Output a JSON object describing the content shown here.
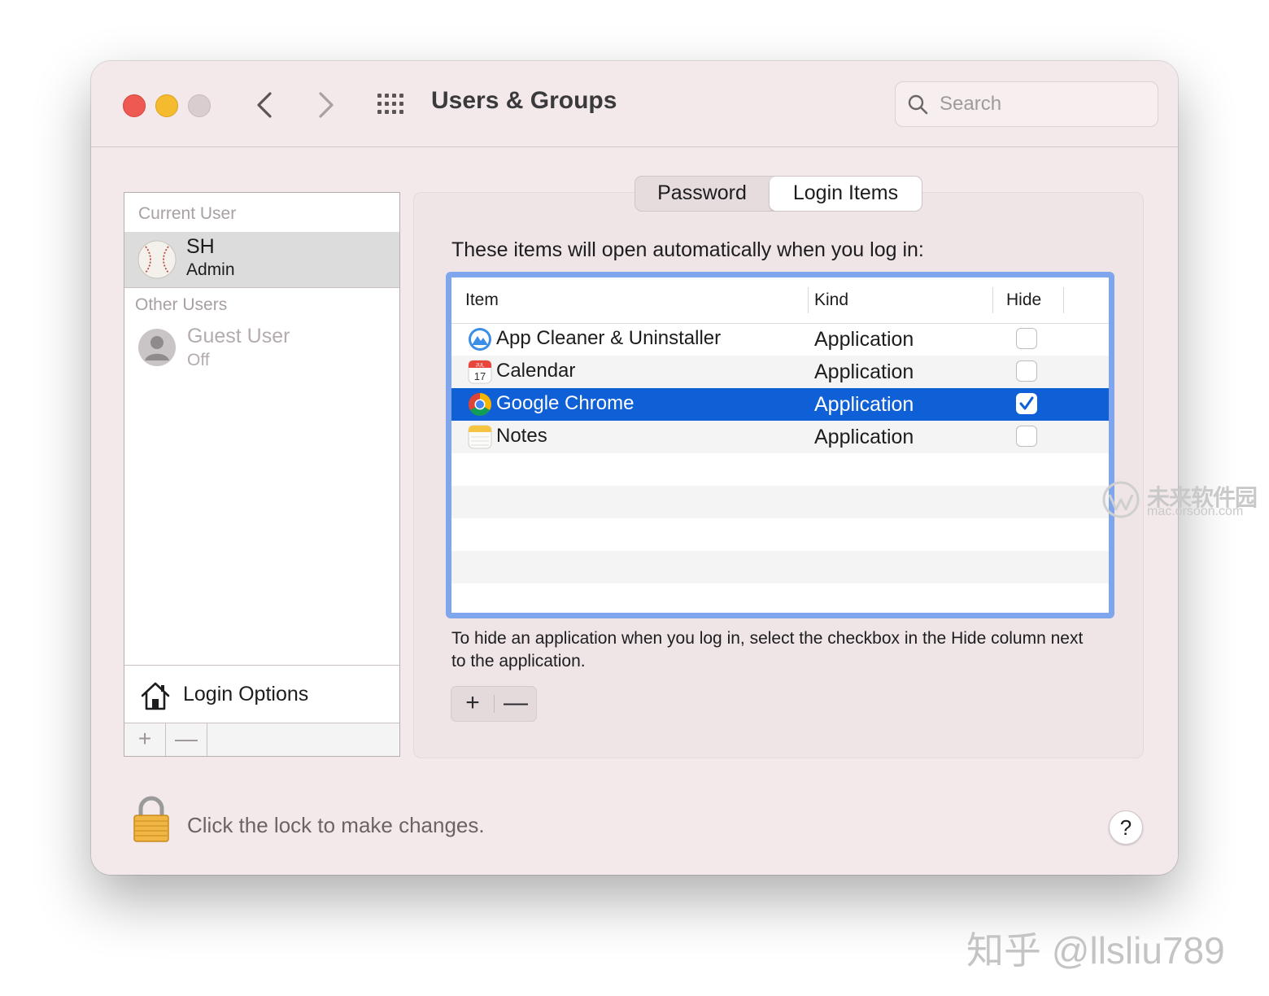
{
  "window": {
    "title": "Users & Groups",
    "search": {
      "placeholder": "Search"
    }
  },
  "sidebar": {
    "current_user_header": "Current User",
    "current_user": {
      "name": "SH",
      "role": "Admin"
    },
    "other_users_header": "Other Users",
    "other_users": [
      {
        "name": "Guest User",
        "status": "Off"
      }
    ],
    "login_options_label": "Login Options",
    "add_label": "+",
    "remove_label": "—"
  },
  "tabs": [
    {
      "label": "Password",
      "selected": false
    },
    {
      "label": "Login Items",
      "selected": true
    }
  ],
  "login_items": {
    "instruction": "These items will open automatically when you log in:",
    "columns": {
      "item": "Item",
      "kind": "Kind",
      "hide": "Hide"
    },
    "rows": [
      {
        "name": "App Cleaner & Uninstaller",
        "kind": "Application",
        "hide": false,
        "icon": "app-cleaner-icon"
      },
      {
        "name": "Calendar",
        "kind": "Application",
        "hide": false,
        "icon": "calendar-icon",
        "icon_month": "JUL",
        "icon_day": "17"
      },
      {
        "name": "Google Chrome",
        "kind": "Application",
        "hide": true,
        "icon": "chrome-icon",
        "selected": true
      },
      {
        "name": "Notes",
        "kind": "Application",
        "hide": false,
        "icon": "notes-icon"
      }
    ],
    "hint": "To hide an application when you log in, select the checkbox in the Hide column next to the application.",
    "add_label": "+",
    "remove_label": "—"
  },
  "footer": {
    "lock_text": "Click the lock to make changes.",
    "help_label": "?"
  },
  "watermarks": {
    "site_cn": "未来软件园",
    "site_url": "mac.orsoon.com",
    "zhihu": "知乎 @llsliu789"
  },
  "colors": {
    "selection": "#0f5fd6",
    "focus_ring": "#7fa6ec",
    "window_bg": "#f3e9ea",
    "close": "#ee5a52",
    "minimize": "#f4bb2e"
  }
}
